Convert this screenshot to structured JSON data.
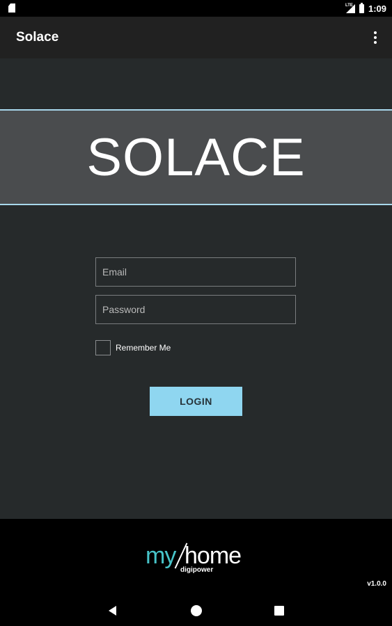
{
  "status_bar": {
    "time": "1:09",
    "network_label": "LTE",
    "icons": [
      "sim-card-icon",
      "cell-signal-icon",
      "battery-icon"
    ]
  },
  "app_bar": {
    "title": "Solace",
    "menu_icon": "overflow-menu-icon"
  },
  "banner": {
    "text": "SOLACE",
    "accent_color": "#a8d8ec"
  },
  "login_form": {
    "email": {
      "placeholder": "Email",
      "value": ""
    },
    "password": {
      "placeholder": "Password",
      "value": ""
    },
    "remember_label": "Remember Me",
    "remember_checked": false,
    "login_label": "LOGIN",
    "button_color": "#8fd6f0"
  },
  "footer": {
    "logo_my": "my",
    "logo_home": "home",
    "logo_sub": "digipower",
    "version": "v1.0.0"
  },
  "nav_bar": {
    "icons": [
      "back-icon",
      "home-icon",
      "recents-icon"
    ]
  }
}
